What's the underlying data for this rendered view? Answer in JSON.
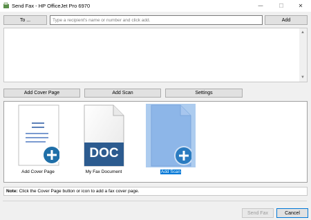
{
  "window": {
    "title": "Send Fax - HP OfficeJet Pro 6970",
    "minimize_glyph": "—",
    "maximize_glyph": "☐",
    "close_glyph": "✕"
  },
  "recipients": {
    "to_button_label": "To ...",
    "input_placeholder": "Type a recipient's name or number and click add.",
    "input_value": "",
    "add_button_label": "Add"
  },
  "action_buttons": {
    "add_cover_page": "Add Cover Page",
    "add_scan": "Add Scan",
    "settings": "Settings"
  },
  "documents": [
    {
      "label": "Add Cover Page",
      "icon": "cover-page-add-icon",
      "selected": false
    },
    {
      "label": "My Fax Document",
      "icon": "doc-file-icon",
      "selected": false
    },
    {
      "label": "Add Scan",
      "icon": "scan-add-icon",
      "selected": true
    }
  ],
  "doc_badge_text": "DOC",
  "note": {
    "prefix": "Note:",
    "text": "Click the Cover Page button or icon to add a fax cover page."
  },
  "footer": {
    "send_fax_label": "Send Fax",
    "cancel_label": "Cancel"
  },
  "colors": {
    "accent": "#0078d7",
    "plus_circle": "#1f6fa8",
    "doc_badge": "#2c5b8f",
    "selection_fill": "#a9c9ee"
  }
}
